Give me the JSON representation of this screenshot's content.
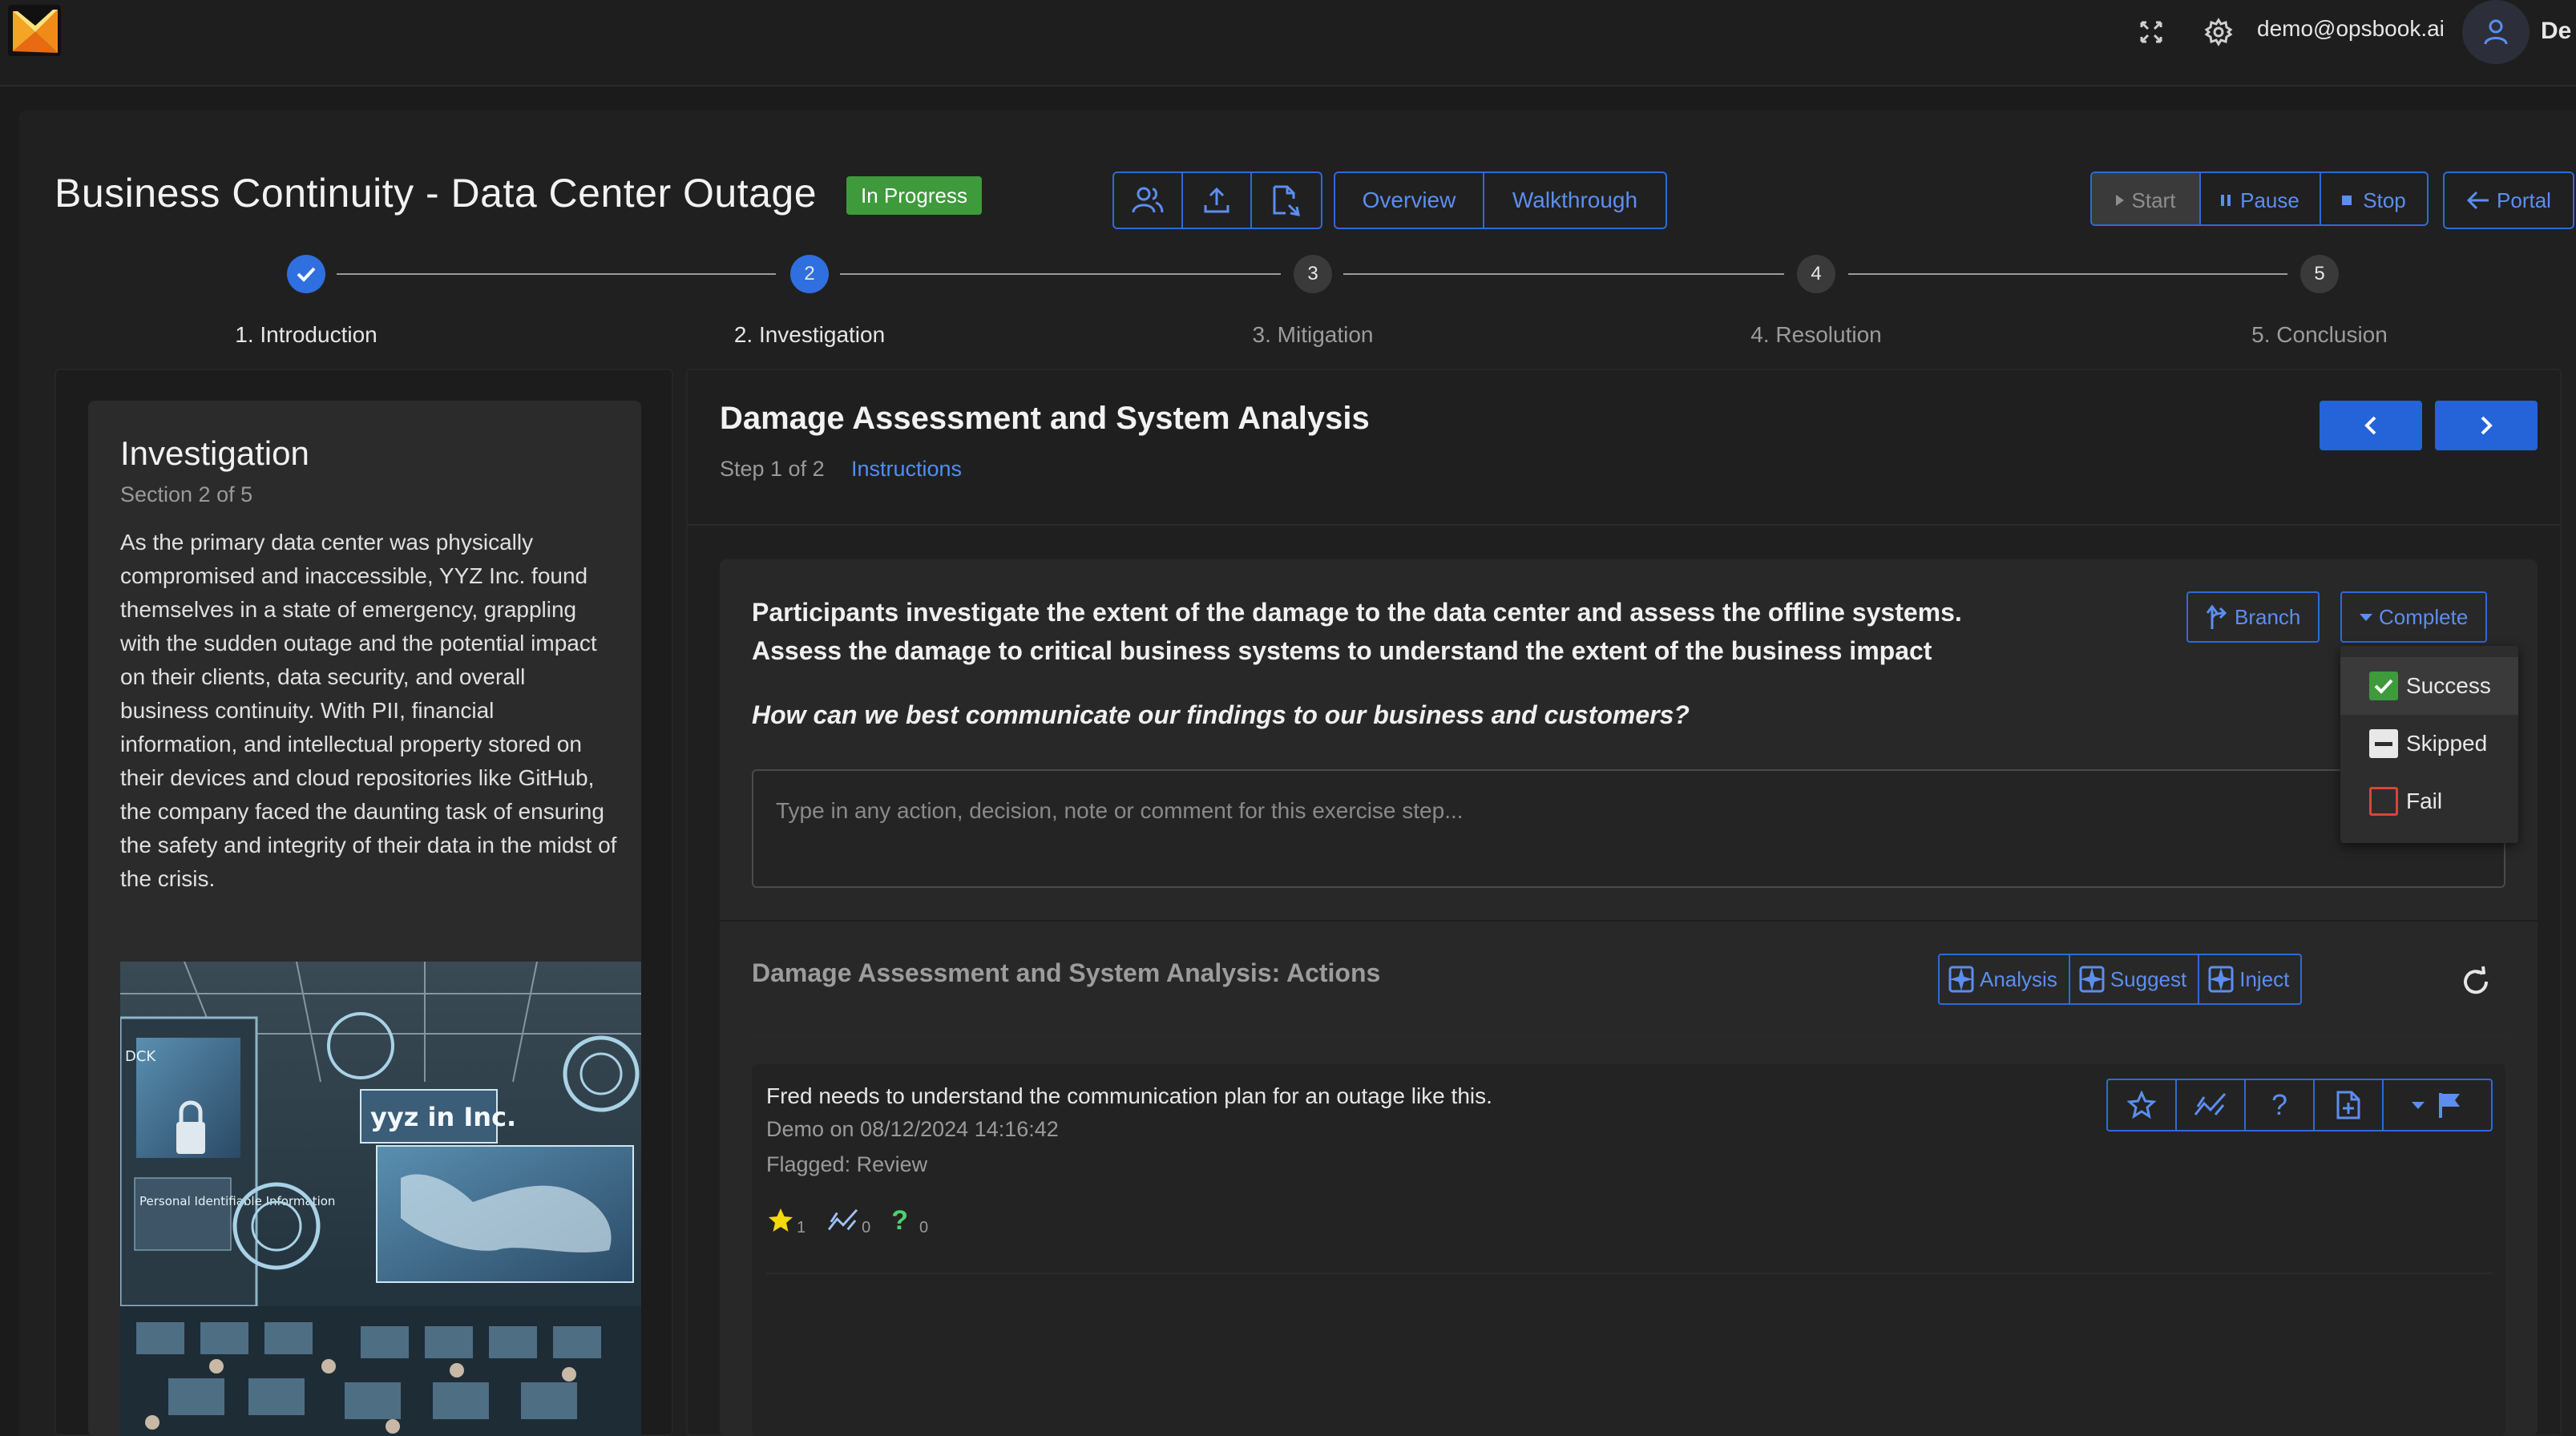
{
  "topbar": {
    "email": "demo@opsbook.ai",
    "user_cut": "De"
  },
  "exercise": {
    "title": "Business Continuity - Data Center Outage",
    "status": "In Progress",
    "status_color": "#3e9a3b",
    "view_tabs": [
      "Overview",
      "Walkthrough"
    ],
    "controls": {
      "start": "Start",
      "pause": "Pause",
      "stop": "Stop",
      "portal": "Portal"
    }
  },
  "stepper": {
    "steps": [
      {
        "number": "1",
        "label": "1. Introduction",
        "state": "done"
      },
      {
        "number": "2",
        "label": "2. Investigation",
        "state": "active"
      },
      {
        "number": "3",
        "label": "3. Mitigation",
        "state": "pending"
      },
      {
        "number": "4",
        "label": "4. Resolution",
        "state": "pending"
      },
      {
        "number": "5",
        "label": "5. Conclusion",
        "state": "pending"
      }
    ]
  },
  "section": {
    "title": "Investigation",
    "subtitle": "Section 2 of 5",
    "body": "As the primary data center was physically compromised and inaccessible, YYZ Inc. found themselves in a state of emergency, grappling with the sudden outage and the potential impact on their clients, data security, and overall business continuity. With PII, financial information, and intellectual property stored on their devices and cloud repositories like GitHub, the company faced the daunting task of ensuring the safety and integrity of their data in the midst of the crisis.",
    "image_text": {
      "banner": "yyz in Inc.",
      "panel": "Personal Identifiable Information",
      "corner": "DCK"
    }
  },
  "step": {
    "title": "Damage Assessment and System Analysis",
    "counter": "Step 1 of 2",
    "instructions_link": "Instructions",
    "description_line1": "Participants investigate the extent of the damage to the data center and assess the offline systems.",
    "description_line2": "Assess the damage to critical business systems to understand the extent of the business impact",
    "question": "How can we best communicate our findings to our business and customers?",
    "input_placeholder": "Type in any action, decision, note or comment for this exercise step...",
    "branch_label": "Branch",
    "complete_label": "Complete",
    "complete_options": [
      "Success",
      "Skipped",
      "Fail"
    ],
    "accent_color": "#2f6fe0"
  },
  "actions": {
    "title": "Damage Assessment and System Analysis: Actions",
    "ai_buttons": [
      "Analysis",
      "Suggest",
      "Inject"
    ],
    "items": [
      {
        "text": "Fred needs to understand the communication plan for an outage like this.",
        "meta": "Demo on 08/12/2024 14:16:42",
        "flag": "Flagged: Review",
        "stars": "1",
        "trends": "0",
        "questions": "0"
      }
    ]
  }
}
